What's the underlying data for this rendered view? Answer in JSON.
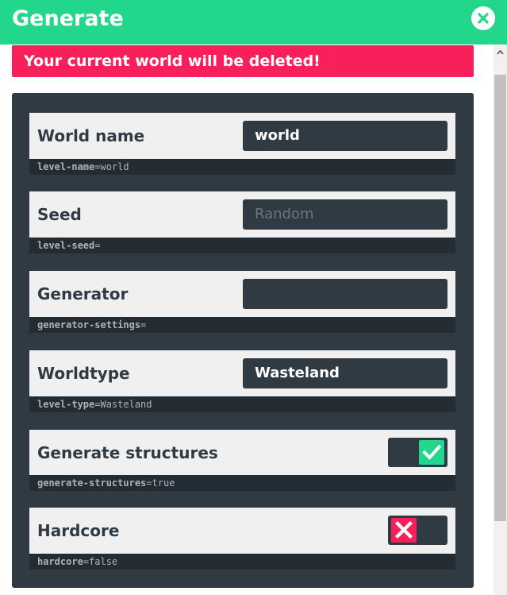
{
  "header": {
    "title": "Generate"
  },
  "warning": {
    "text": "Your current world will be deleted!"
  },
  "fields": [
    {
      "label": "World name",
      "type": "text",
      "value": "world",
      "placeholder": "",
      "key": "level-name",
      "key_value": "world"
    },
    {
      "label": "Seed",
      "type": "text",
      "value": "",
      "placeholder": "Random",
      "key": "level-seed",
      "key_value": ""
    },
    {
      "label": "Generator",
      "type": "text",
      "value": "",
      "placeholder": "",
      "key": "generator-settings",
      "key_value": ""
    },
    {
      "label": "Worldtype",
      "type": "select",
      "value": "Wasteland",
      "placeholder": "",
      "key": "level-type",
      "key_value": "Wasteland"
    },
    {
      "label": "Generate structures",
      "type": "toggle",
      "checked": true,
      "icon": "check-icon",
      "key": "generate-structures",
      "key_value": "true"
    },
    {
      "label": "Hardcore",
      "type": "toggle",
      "checked": false,
      "icon": "x-icon",
      "key": "hardcore",
      "key_value": "false"
    }
  ],
  "colors": {
    "accent": "#22d68b",
    "danger": "#f8205a",
    "panel": "#2f3a43",
    "key_bar": "#232c33",
    "field_bg": "#f0f0f0"
  }
}
